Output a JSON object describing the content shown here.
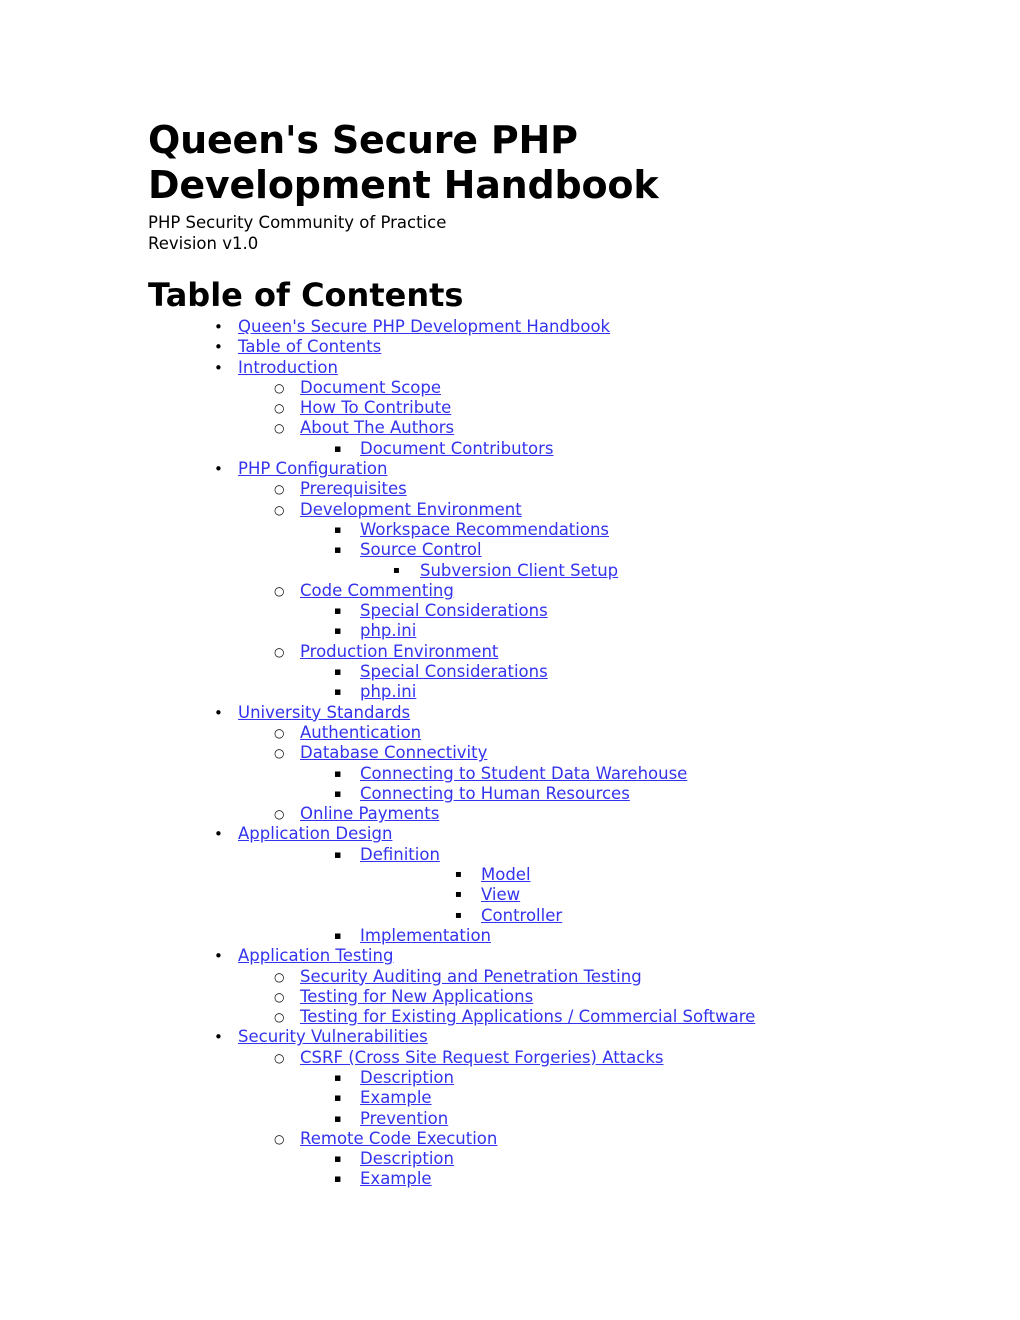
{
  "document": {
    "title": "Queen's Secure PHP Development Handbook",
    "subtitle": "PHP Security Community of Practice",
    "revision": "Revision v1.0",
    "link_color": "#3333EE",
    "text_color": "#000000",
    "background_color": "#FFFFFF"
  },
  "toc": {
    "heading": "Table of Contents",
    "entries": [
      {
        "label": "Queen's Secure PHP Development Handbook",
        "level": 1,
        "marker": "disc"
      },
      {
        "label": "Table of Contents",
        "level": 1,
        "marker": "disc"
      },
      {
        "label": "Introduction",
        "level": 1,
        "marker": "disc"
      },
      {
        "label": "Document Scope",
        "level": 2,
        "marker": "circle"
      },
      {
        "label": "How To Contribute",
        "level": 2,
        "marker": "circle"
      },
      {
        "label": "About The Authors",
        "level": 2,
        "marker": "circle"
      },
      {
        "label": "Document Contributors",
        "level": 3,
        "marker": "square"
      },
      {
        "label": "PHP Configuration",
        "level": 1,
        "marker": "disc"
      },
      {
        "label": "Prerequisites",
        "level": 2,
        "marker": "circle"
      },
      {
        "label": "Development Environment",
        "level": 2,
        "marker": "circle"
      },
      {
        "label": "Workspace Recommendations",
        "level": 3,
        "marker": "square"
      },
      {
        "label": "Source Control",
        "level": 3,
        "marker": "square"
      },
      {
        "label": "Subversion Client Setup",
        "level": 4,
        "marker": "square"
      },
      {
        "label": "Code Commenting",
        "level": 2,
        "marker": "circle"
      },
      {
        "label": "Special Considerations",
        "level": 3,
        "marker": "square"
      },
      {
        "label": "php.ini",
        "level": 3,
        "marker": "square"
      },
      {
        "label": "Production Environment",
        "level": 2,
        "marker": "circle"
      },
      {
        "label": "Special Considerations",
        "level": 3,
        "marker": "square"
      },
      {
        "label": "php.ini",
        "level": 3,
        "marker": "square"
      },
      {
        "label": "University Standards",
        "level": 1,
        "marker": "disc"
      },
      {
        "label": "Authentication",
        "level": 2,
        "marker": "circle"
      },
      {
        "label": "Database Connectivity",
        "level": 2,
        "marker": "circle"
      },
      {
        "label": "Connecting to Student Data Warehouse",
        "level": 3,
        "marker": "square"
      },
      {
        "label": "Connecting to Human Resources",
        "level": 3,
        "marker": "square"
      },
      {
        "label": "Online Payments",
        "level": 2,
        "marker": "circle"
      },
      {
        "label": "Application Design",
        "level": 1,
        "marker": "disc"
      },
      {
        "label": "Definition",
        "level": 3,
        "marker": "square"
      },
      {
        "label": "Model",
        "level": 5,
        "marker": "square"
      },
      {
        "label": "View",
        "level": 5,
        "marker": "square"
      },
      {
        "label": "Controller",
        "level": 5,
        "marker": "square"
      },
      {
        "label": "Implementation",
        "level": 3,
        "marker": "square"
      },
      {
        "label": "Application Testing",
        "level": 1,
        "marker": "disc"
      },
      {
        "label": "Security Auditing and Penetration Testing",
        "level": 2,
        "marker": "circle"
      },
      {
        "label": "Testing for New Applications",
        "level": 2,
        "marker": "circle"
      },
      {
        "label": "Testing for Existing Applications / Commercial Software",
        "level": 2,
        "marker": "circle"
      },
      {
        "label": "Security Vulnerabilities",
        "level": 1,
        "marker": "disc"
      },
      {
        "label": "CSRF (Cross Site Request Forgeries) Attacks",
        "level": 2,
        "marker": "circle"
      },
      {
        "label": "Description",
        "level": 3,
        "marker": "square"
      },
      {
        "label": "Example",
        "level": 3,
        "marker": "square"
      },
      {
        "label": "Prevention",
        "level": 3,
        "marker": "square"
      },
      {
        "label": "Remote Code Execution",
        "level": 2,
        "marker": "circle"
      },
      {
        "label": "Description",
        "level": 3,
        "marker": "square"
      },
      {
        "label": "Example",
        "level": 3,
        "marker": "square"
      }
    ]
  }
}
